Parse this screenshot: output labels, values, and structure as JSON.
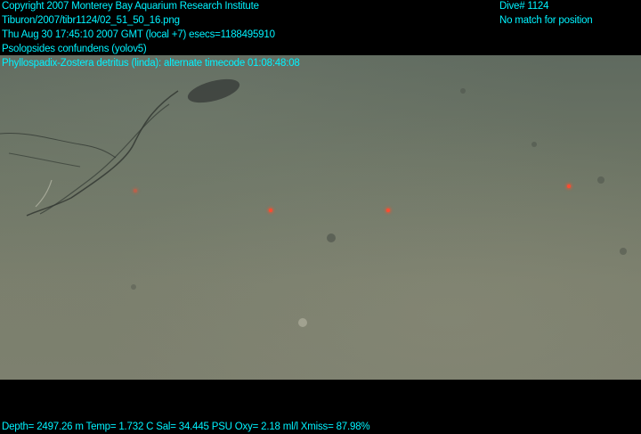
{
  "header": {
    "copyright": "Copyright 2007 Monterey Bay Aquarium Research Institute",
    "filename": "Tiburon/2007/tibr1124/02_51_50_16.png",
    "datetime": "Thu Aug 30 17:45:10 2007 GMT (local +7)  esecs=1188495910",
    "annotation_1": "Psolopsides confundens (yolov5)",
    "annotation_2": "Phyllospadix-Zostera detritus (linda): alternate timecode 01:08:48:08",
    "dive": "Dive# 1124",
    "position": "No match for position"
  },
  "footer": {
    "telemetry": "Depth= 2497.26 m  Temp= 1.732 C  Sal= 34.445 PSU  Oxy= 2.18 ml/l  Xmiss= 87.98%"
  },
  "colors": {
    "overlay_text": "#00f3ff",
    "laser": "#ff4a30"
  }
}
